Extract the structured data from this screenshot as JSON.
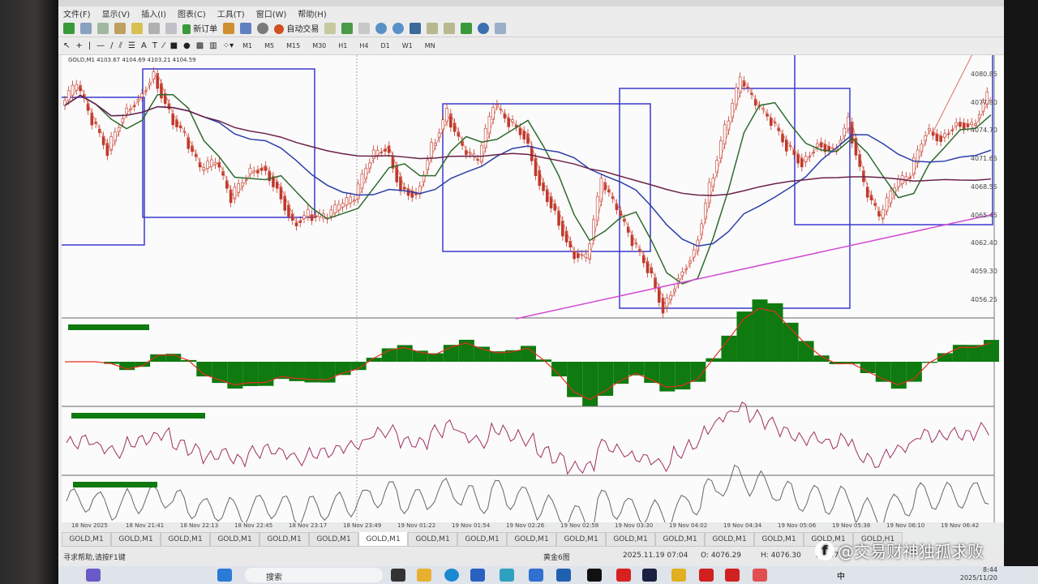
{
  "menu": [
    "文件(F)",
    "显示(V)",
    "插入(I)",
    "图表(C)",
    "工具(T)",
    "窗口(W)",
    "帮助(H)"
  ],
  "toolbar": {
    "new_order": "新订单",
    "auto_trade": "自动交易"
  },
  "timeframes": [
    "M1",
    "M5",
    "M15",
    "M30",
    "H1",
    "H4",
    "D1",
    "W1",
    "MN"
  ],
  "chart_header": "GOLD,M1  4103.67 4104.69 4103.21 4104.59",
  "price_axis": [
    "4080.85",
    "4077.80",
    "4074.70",
    "4071.65",
    "4068.55",
    "4065.45",
    "4062.40",
    "4059.30",
    "4056.25"
  ],
  "time_axis": [
    "18 Nov 2025",
    "18 Nov 21:41",
    "18 Nov 22:13",
    "18 Nov 22:45",
    "18 Nov 23:17",
    "18 Nov 23:49",
    "19 Nov 01:22",
    "19 Nov 01:54",
    "19 Nov 02:26",
    "19 Nov 02:58",
    "19 Nov 03:30",
    "19 Nov 04:02",
    "19 Nov 04:34",
    "19 Nov 05:06",
    "19 Nov 05:38",
    "19 Nov 06:10",
    "19 Nov 06:42"
  ],
  "chart_data": {
    "type": "line",
    "symbol": "GOLD",
    "timeframe": "M1",
    "ylim": [
      4055,
      4082
    ],
    "close": [
      4077.4,
      4079.6,
      4075.6,
      4072.5,
      4076.5,
      4078.3,
      4080.9,
      4076.5,
      4073.9,
      4070.3,
      4071.2,
      4067.2,
      4069.9,
      4070.8,
      4068.5,
      4064.6,
      4065.5,
      4065.0,
      4066.3,
      4067.2,
      4071.6,
      4073.0,
      4068.5,
      4067.7,
      4073.0,
      4076.5,
      4072.5,
      4071.2,
      4077.4,
      4075.6,
      4074.3,
      4069.0,
      4065.9,
      4061.5,
      4060.6,
      4069.0,
      4065.9,
      4062.4,
      4059.7,
      4055.3,
      4058.8,
      4061.5,
      4068.5,
      4074.7,
      4080.1,
      4077.4,
      4075.6,
      4073.0,
      4071.2,
      4073.4,
      4072.5,
      4075.6,
      4068.5,
      4065.0,
      4068.5,
      4069.9,
      4074.7,
      4073.9,
      4075.6,
      4075.2,
      4078.3
    ]
  },
  "tabs": [
    "GOLD,M1",
    "GOLD,M1",
    "GOLD,M1",
    "GOLD,M1",
    "GOLD,M1",
    "GOLD,M1",
    "GOLD,M1",
    "GOLD,M1",
    "GOLD,M1",
    "GOLD,M1",
    "GOLD,M1",
    "GOLD,M1",
    "GOLD,M1",
    "GOLD,M1",
    "GOLD,M1",
    "GOLD,M1",
    "GOLD,H1"
  ],
  "active_tab": 6,
  "status": {
    "help": "寻求帮助,请按F1键",
    "profile": "黄金6图",
    "datetime": "2025.11.19 07:04",
    "open": "O: 4076.29",
    "high": "H: 4076.30",
    "low": "L: 407"
  },
  "taskbar": {
    "search": "搜索",
    "time": "8:44",
    "date": "2025/11/20",
    "ime": "中"
  },
  "watermark": "@交易财神独孤求败",
  "colors": {
    "up": "#c0392b",
    "ma_fast": "#2e6b2e",
    "ma_mid": "#2b3fa8",
    "ma_slow": "#6b2148",
    "ma_long": "#d24bd2",
    "box": "#3a3ad0",
    "macd": "#0f7a0f"
  }
}
